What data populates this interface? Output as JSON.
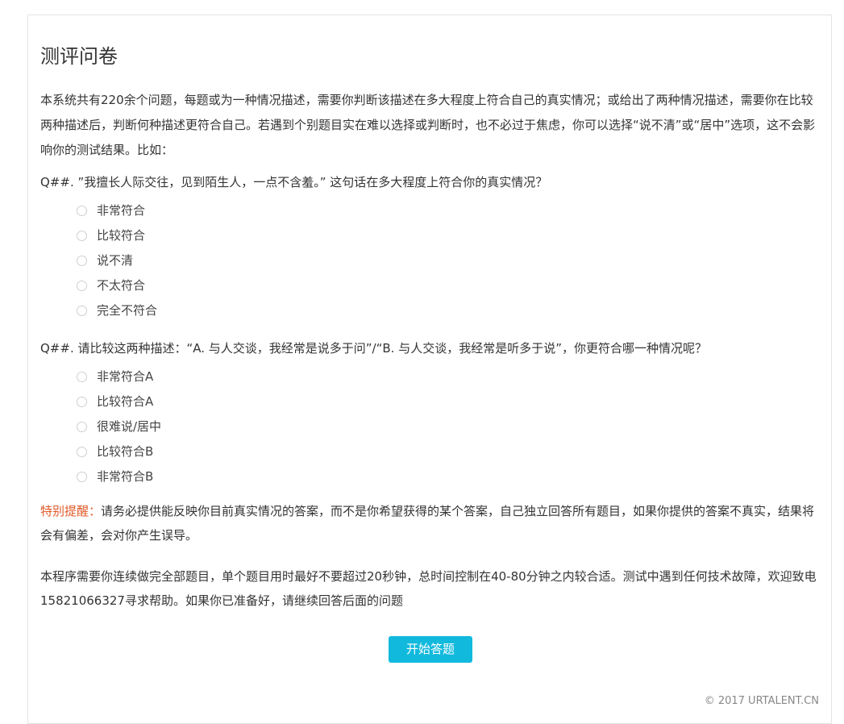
{
  "page": {
    "title": "测评问卷",
    "intro": "本系统共有220余个问题，每题或为一种情况描述，需要你判断该描述在多大程度上符合自己的真实情况；或给出了两种情况描述，需要你在比较两种描述后，判断何种描述更符合自己。若遇到个别题目实在难以选择或判断时，也不必过于焦虑，你可以选择“说不清”或“居中”选项，这不会影响你的测试结果。比如："
  },
  "question1": {
    "text": "Q##. ”我擅长人际交往，见到陌生人，一点不含羞。” 这句话在多大程度上符合你的真实情况？",
    "options": [
      "非常符合",
      "比较符合",
      "说不清",
      "不太符合",
      "完全不符合"
    ]
  },
  "question2": {
    "text": "Q##.  请比较这两种描述：“A. 与人交谈，我经常是说多于问”/“B. 与人交谈，我经常是听多于说”，你更符合哪一种情况呢？",
    "options": [
      "非常符合A",
      "比较符合A",
      "很难说/居中",
      "比较符合B",
      "非常符合B"
    ]
  },
  "notice": {
    "label": "特别提醒：",
    "text": "请务必提供能反映你目前真实情况的答案，而不是你希望获得的某个答案，自己独立回答所有题目，如果你提供的答案不真实，结果将会有偏差，会对你产生误导。"
  },
  "program": {
    "text": "本程序需要你连续做完全部题目，单个题目用时最好不要超过20秒钟，总时间控制在40-80分钟之内较合适。测试中遇到任何技术故障，欢迎致电15821066327寻求帮助。如果你已准备好，请继续回答后面的问题"
  },
  "start_button": {
    "label": "开始答题"
  },
  "footer": {
    "copyright": "© 2017 URTALENT.CN"
  },
  "colors": {
    "accent": "#11b9dd",
    "notice": "#e05a28",
    "text": "#333333",
    "border": "#e4e4e4"
  },
  "icons": {
    "radio": "radio-circle-icon"
  }
}
